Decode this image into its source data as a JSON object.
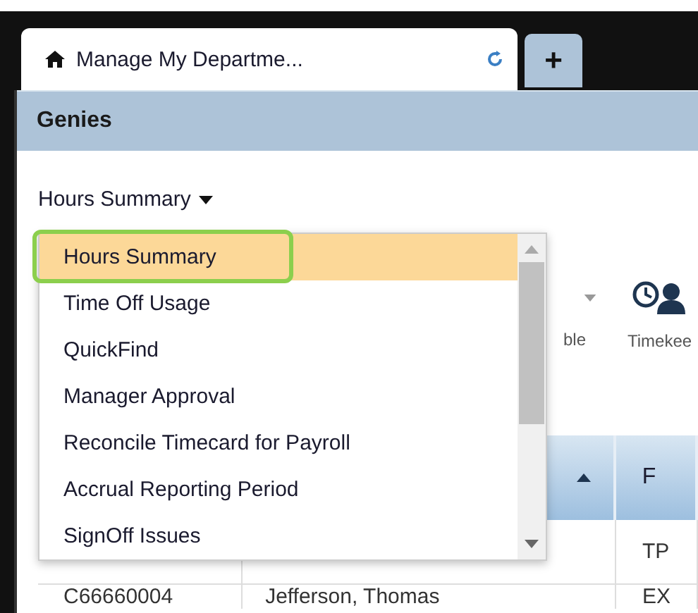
{
  "tabs": [
    {
      "label": "Manage My Departme...",
      "selected": true,
      "kind": "page"
    },
    {
      "label": "+",
      "selected": false,
      "kind": "add"
    }
  ],
  "panel": {
    "title": "Genies"
  },
  "genie_select": {
    "value": "Hours Summary"
  },
  "dropdown": {
    "items": [
      {
        "label": "Hours Summary",
        "selected": true
      },
      {
        "label": "Time Off Usage",
        "selected": false
      },
      {
        "label": "QuickFind",
        "selected": false
      },
      {
        "label": "Manager Approval",
        "selected": false
      },
      {
        "label": "Reconcile Timecard for Payroll",
        "selected": false
      },
      {
        "label": "Accrual Reporting Period",
        "selected": false
      },
      {
        "label": "SignOff Issues",
        "selected": false
      }
    ]
  },
  "toolbar": [
    {
      "label": "ble"
    },
    {
      "label": "Timekee"
    }
  ],
  "table": {
    "columns": [
      "",
      "",
      "F"
    ],
    "rows": [
      [
        "",
        "",
        "TP"
      ],
      [
        "C66660004",
        "Jefferson, Thomas",
        "EX"
      ]
    ]
  }
}
